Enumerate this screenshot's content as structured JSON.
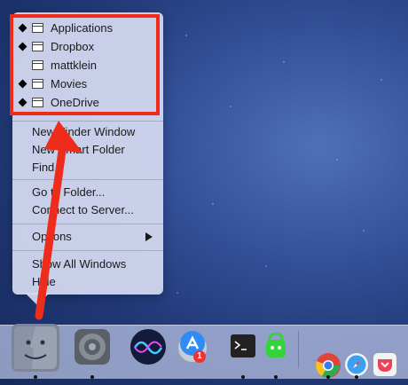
{
  "finder_dock_menu": {
    "folders": [
      {
        "label": "Applications",
        "marked": true
      },
      {
        "label": "Dropbox",
        "marked": true
      },
      {
        "label": "mattklein",
        "marked": false
      },
      {
        "label": "Movies",
        "marked": true
      },
      {
        "label": "OneDrive",
        "marked": true
      }
    ],
    "commands": {
      "new_finder_window": "New Finder Window",
      "new_smart_folder": "New Smart Folder",
      "find": "Find",
      "go_to_folder": "Go to Folder...",
      "connect_to_server": "Connect to Server...",
      "options": "Options",
      "show_all_windows": "Show All Windows",
      "hide": "Hide"
    }
  },
  "dock": {
    "app_store_badge": "1",
    "items": [
      "finder-icon",
      "system-preferences-icon",
      "siri-icon",
      "launchpad-icon",
      "app-store-icon",
      "terminal-icon",
      "vpn-icon",
      "chrome-icon",
      "safari-icon",
      "pocket-icon"
    ]
  },
  "colors": {
    "highlight": "#ee2c1c",
    "arrow": "#ee2c1c",
    "menu_bg": "#d6daf1"
  }
}
